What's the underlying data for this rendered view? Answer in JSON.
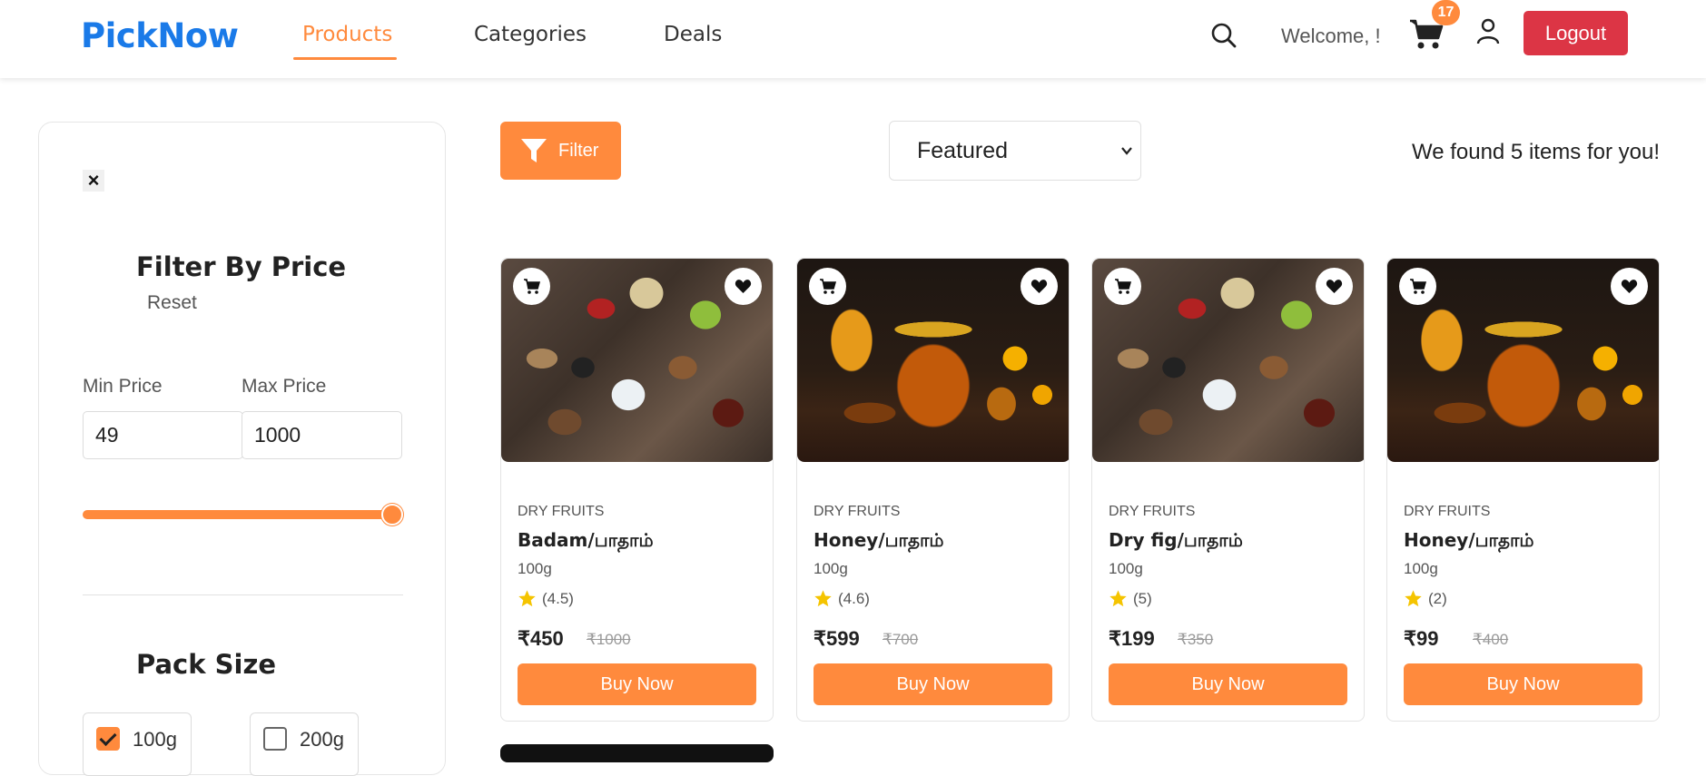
{
  "header": {
    "logo": "PickNow",
    "nav": [
      {
        "label": "Products",
        "active": true
      },
      {
        "label": "Categories",
        "active": false
      },
      {
        "label": "Deals",
        "active": false
      }
    ],
    "welcome": "Welcome, !",
    "cart_count": "17",
    "logout_label": "Logout",
    "icons": [
      "search-icon",
      "cart-icon",
      "user-icon"
    ]
  },
  "sidebar": {
    "close": "×",
    "price_title": "Filter By Price",
    "reset_label": "Reset",
    "min_label": "Min Price",
    "max_label": "Max Price",
    "min_value": "49",
    "max_value": "1000",
    "pack_title": "Pack Size",
    "pack_options": [
      {
        "label": "100g",
        "checked": true
      },
      {
        "label": "200g",
        "checked": false
      }
    ]
  },
  "toolbar": {
    "filter_label": "Filter",
    "sort_selected": "Featured",
    "found_text": "We found 5 items for you!"
  },
  "products": [
    {
      "category": "DRY FRUITS",
      "name": "Badam/பாதாம்",
      "weight": "100g",
      "rating": "(4.5)",
      "price": "₹450",
      "mrp": "₹1000",
      "buy_label": "Buy Now",
      "image": "nuts"
    },
    {
      "category": "DRY FRUITS",
      "name": "Honey/பாதாம்",
      "weight": "100g",
      "rating": "(4.6)",
      "price": "₹599",
      "mrp": "₹700",
      "buy_label": "Buy Now",
      "image": "honey"
    },
    {
      "category": "DRY FRUITS",
      "name": "Dry fig/பாதாம்",
      "weight": "100g",
      "rating": "(5)",
      "price": "₹199",
      "mrp": "₹350",
      "buy_label": "Buy Now",
      "image": "nuts"
    },
    {
      "category": "DRY FRUITS",
      "name": "Honey/பாதாம்",
      "weight": "100g",
      "rating": "(2)",
      "price": "₹99",
      "mrp": "₹400",
      "buy_label": "Buy Now",
      "image": "honey"
    }
  ],
  "colors": {
    "brand": "#1a7ae8",
    "accent": "#ff8a3d",
    "danger": "#dc3545",
    "star": "#f5c400"
  }
}
